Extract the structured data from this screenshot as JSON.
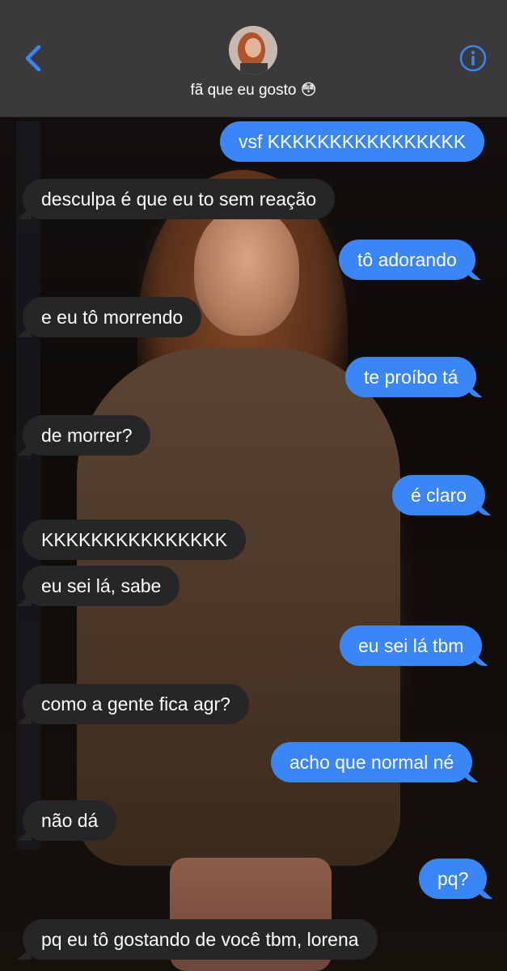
{
  "header": {
    "contact_name": "fã que eu gosto 😳",
    "back_icon": "chevron-left-icon",
    "info_icon": "info-icon",
    "accent_color": "#3b86f7"
  },
  "messages": [
    {
      "from": "me",
      "text": "vsf KKKKKKKKKKKKKKKK"
    },
    {
      "from": "them",
      "text": "desculpa é que eu to sem reação"
    },
    {
      "from": "me",
      "text": "tô adorando"
    },
    {
      "from": "them",
      "text": "e eu tô morrendo"
    },
    {
      "from": "me",
      "text": "te proíbo tá"
    },
    {
      "from": "them",
      "text": "de morrer?"
    },
    {
      "from": "me",
      "text": "é claro"
    },
    {
      "from": "them",
      "text": "KKKKKKKKKKKKKKK"
    },
    {
      "from": "them",
      "text": "eu sei lá, sabe"
    },
    {
      "from": "me",
      "text": "eu sei lá tbm"
    },
    {
      "from": "them",
      "text": "como a gente fica agr?"
    },
    {
      "from": "me",
      "text": "acho que normal né"
    },
    {
      "from": "them",
      "text": "não dá"
    },
    {
      "from": "me",
      "text": "pq?"
    },
    {
      "from": "them",
      "text": "pq eu tô gostando de você tbm, lorena"
    }
  ]
}
